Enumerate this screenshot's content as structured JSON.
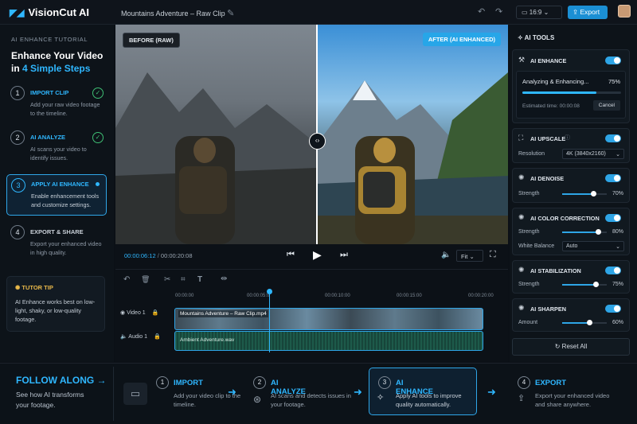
{
  "app": {
    "name": "VisionCut AI",
    "project": "Mountains Adventure – Raw Clip",
    "aspect": "16:9",
    "export_label": "Export"
  },
  "tutorial": {
    "section_label": "AI ENHANCE TUTORIAL",
    "title_line1": "Enhance Your Video",
    "title_in": "in",
    "title_accent": "4 Simple Steps",
    "steps": [
      {
        "num": "1",
        "title": "IMPORT CLIP",
        "desc": "Add your raw video footage to the timeline.",
        "done": true
      },
      {
        "num": "2",
        "title": "AI ANALYZE",
        "desc": "AI scans your video to identify issues.",
        "done": true
      },
      {
        "num": "3",
        "title": "APPLY AI ENHANCE",
        "desc": "Enable enhancement tools and customize settings.",
        "active": true
      },
      {
        "num": "4",
        "title": "EXPORT & SHARE",
        "desc": "Export your enhanced video in high quality."
      }
    ],
    "tip_title": "TUTOR TIP",
    "tip_text": "AI Enhance works best on low-light, shaky, or low-quality footage."
  },
  "preview": {
    "before_label": "BEFORE (RAW)",
    "after_label": "AFTER (AI ENHANCED)"
  },
  "playback": {
    "current": "00:00:06:12",
    "sep": "/",
    "total": "00:00:20:08",
    "fit": "Fit"
  },
  "timeline": {
    "ruler": [
      "00:00:00",
      "00:00:05:0",
      "00:00:10:00",
      "00:00:15:00",
      "00:00:20:00"
    ],
    "video_track": "Video 1",
    "audio_track": "Audio 1",
    "video_clip": "Mountains Adventure – Raw Clip.mp4",
    "audio_clip": "Ambient Adventure.wav"
  },
  "tools": {
    "header": "AI TOOLS",
    "enhance": {
      "label": "AI ENHANCE",
      "status": "Analyzing & Enhancing...",
      "progress": 75,
      "progress_label": "75%",
      "estimate": "Estimated time: 00:00:08",
      "cancel": "Cancel"
    },
    "upscale": {
      "label": "AI UPSCALE",
      "res_label": "Resolution",
      "res_value": "4K (3840x2160)"
    },
    "denoise": {
      "label": "AI DENOISE",
      "strength_label": "Strength",
      "value": 70,
      "value_label": "70%"
    },
    "color": {
      "label": "AI COLOR CORRECTION",
      "strength_label": "Strength",
      "value": 80,
      "value_label": "80%",
      "wb_label": "White Balance",
      "wb_value": "Auto"
    },
    "stabilization": {
      "label": "AI STABILIZATION",
      "strength_label": "Strength",
      "value": 75,
      "value_label": "75%"
    },
    "sharpen": {
      "label": "AI SHARPEN",
      "amount_label": "Amount",
      "value": 60,
      "value_label": "60%"
    },
    "reset": "Reset All"
  },
  "follow": {
    "title": "FOLLOW ALONG",
    "desc": "See how AI transforms your footage.",
    "steps": [
      {
        "num": "1",
        "title": "IMPORT",
        "desc": "Add your video clip to the timeline."
      },
      {
        "num": "2",
        "title": "AI ANALYZE",
        "desc": "AI scans and detects issues in your footage."
      },
      {
        "num": "3",
        "title": "AI ENHANCE",
        "desc": "Apply AI tools to improve quality automatically."
      },
      {
        "num": "4",
        "title": "EXPORT",
        "desc": "Export your enhanced video and share anywhere."
      }
    ]
  }
}
